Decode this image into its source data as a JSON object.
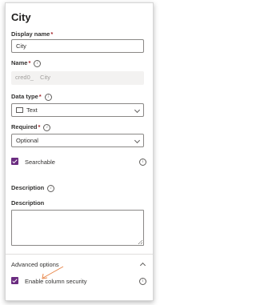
{
  "panel": {
    "title": "City"
  },
  "display_name": {
    "label": "Display name",
    "required_mark": "*",
    "value": "City"
  },
  "name": {
    "label": "Name",
    "required_mark": "*",
    "prefix": "cred0_",
    "value": "City"
  },
  "data_type": {
    "label": "Data type",
    "required_mark": "*",
    "value": "Text",
    "icon": "text-field-icon"
  },
  "required": {
    "label": "Required",
    "required_mark": "*",
    "value": "Optional"
  },
  "searchable": {
    "label": "Searchable",
    "checked": true
  },
  "description_header": {
    "label": "Description"
  },
  "description": {
    "label": "Description",
    "value": ""
  },
  "advanced": {
    "label": "Advanced options",
    "expanded": true,
    "enable_column_security": {
      "label": "Enable column security",
      "checked": true
    }
  },
  "colors": {
    "accent": "#6b2c80",
    "annotation_arrow": "#e8874a"
  }
}
